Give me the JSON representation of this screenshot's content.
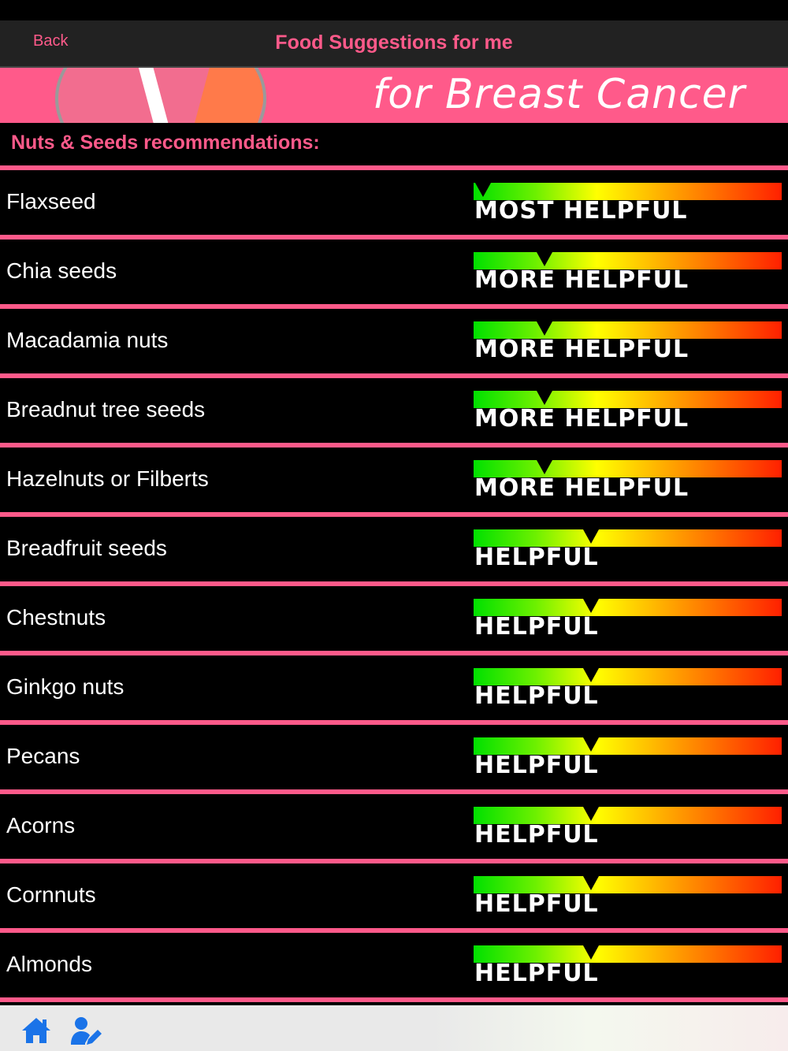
{
  "nav": {
    "back_label": "Back",
    "title": "Food Suggestions for me"
  },
  "banner": {
    "text": "for Breast Cancer"
  },
  "section": {
    "title": "Nuts & Seeds recommendations:"
  },
  "items": [
    {
      "name": "Flaxseed",
      "rating": "MOST HELPFUL",
      "level": 0.0
    },
    {
      "name": "Chia seeds",
      "rating": "MORE HELPFUL",
      "level": 0.2
    },
    {
      "name": "Macadamia nuts",
      "rating": "MORE HELPFUL",
      "level": 0.2
    },
    {
      "name": "Breadnut tree seeds",
      "rating": "MORE HELPFUL",
      "level": 0.2
    },
    {
      "name": "Hazelnuts or Filberts",
      "rating": "MORE HELPFUL",
      "level": 0.2
    },
    {
      "name": "Breadfruit seeds",
      "rating": "HELPFUL",
      "level": 0.35
    },
    {
      "name": "Chestnuts",
      "rating": "HELPFUL",
      "level": 0.35
    },
    {
      "name": "Ginkgo nuts",
      "rating": "HELPFUL",
      "level": 0.35
    },
    {
      "name": "Pecans",
      "rating": "HELPFUL",
      "level": 0.35
    },
    {
      "name": "Acorns",
      "rating": "HELPFUL",
      "level": 0.35
    },
    {
      "name": "Cornnuts",
      "rating": "HELPFUL",
      "level": 0.35
    },
    {
      "name": "Almonds",
      "rating": "HELPFUL",
      "level": 0.35
    }
  ],
  "toolbar": {
    "home_icon": "home-icon",
    "profile_edit_icon": "user-edit-icon"
  },
  "colors": {
    "accent": "#ff5a8a",
    "icon_blue": "#1a73e8"
  }
}
